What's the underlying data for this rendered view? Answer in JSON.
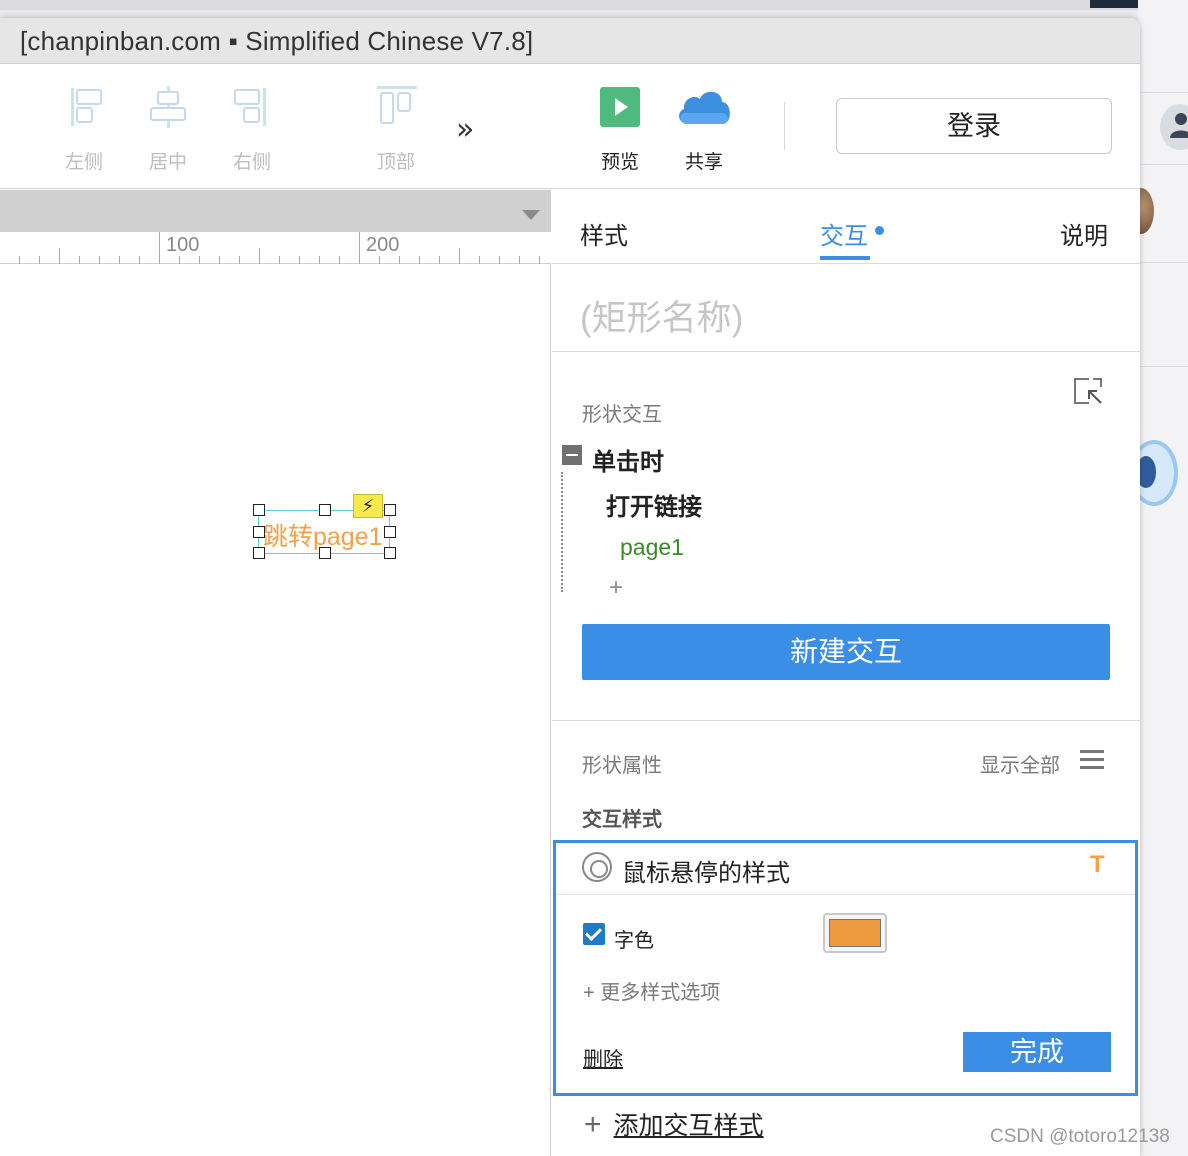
{
  "window": {
    "title": "[chanpinban.com ▪ Simplified Chinese V7.8]"
  },
  "toolbar": {
    "align_left": "左侧",
    "align_center": "居中",
    "align_right": "右侧",
    "align_top": "顶部",
    "more": "»",
    "preview": "预览",
    "share": "共享",
    "login": "登录"
  },
  "canvas": {
    "ruler_marks": [
      "100",
      "200"
    ],
    "widget_text": "跳转page1"
  },
  "panel": {
    "tabs": [
      "样式",
      "交互",
      "说明"
    ],
    "active_tab": "交互",
    "name_placeholder": "(矩形名称)",
    "shape_interaction_label": "形状交互",
    "event": "单击时",
    "action": "打开链接",
    "target": "page1",
    "add_action": "+",
    "new_interaction_button": "新建交互",
    "shape_properties_label": "形状属性",
    "show_all": "显示全部",
    "interaction_styles_label": "交互样式",
    "style_editor": {
      "title": "鼠标悬停的样式",
      "type_icon": "T",
      "font_color_label": "字色",
      "font_color_checked": true,
      "font_color_value": "#ED9A3F",
      "more_options": "+ 更多样式选项",
      "delete": "删除",
      "done": "完成"
    },
    "add_interaction_style": "添加交互样式"
  },
  "watermark": "CSDN @totoro12138",
  "colors": {
    "accent": "#3A8EE6",
    "link_green": "#3A8A2C",
    "orange": "#F2A24A"
  }
}
